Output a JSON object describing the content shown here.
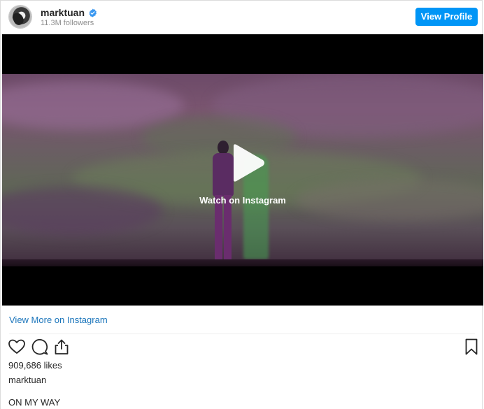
{
  "header": {
    "username": "marktuan",
    "followers": "11.3M followers",
    "view_profile_label": "View Profile",
    "verified_icon": "verified-badge-icon",
    "avatar": "profile-avatar"
  },
  "media": {
    "watch_label": "Watch on Instagram",
    "play_icon": "play-icon"
  },
  "footer": {
    "view_more_label": "View More on Instagram",
    "likes": "909,686 likes",
    "caption_user": "marktuan",
    "caption_text": "ON MY WAY"
  },
  "icons": {
    "like": "heart-icon",
    "comment": "comment-icon",
    "share": "share-icon",
    "save": "bookmark-icon"
  },
  "colors": {
    "accent": "#0095f6",
    "link": "#1b75bb",
    "verified": "#3897f0",
    "text": "#262626",
    "muted": "#8e8e8e"
  }
}
